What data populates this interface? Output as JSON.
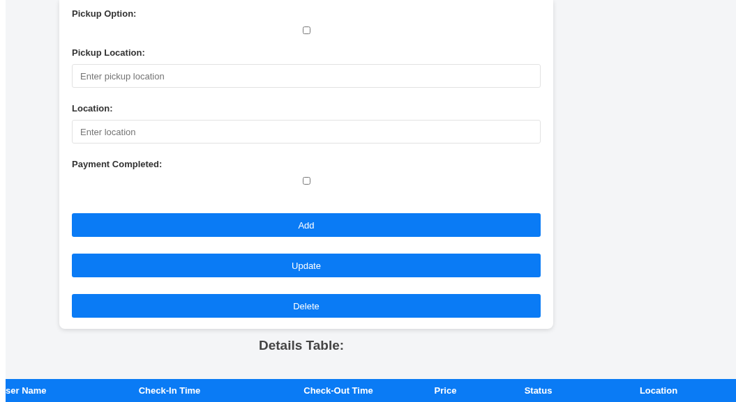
{
  "form": {
    "fields": [
      {
        "kind": "checkbox",
        "label": "Pickup Option:",
        "checked": false
      },
      {
        "kind": "text",
        "label": "Pickup Location:",
        "placeholder": "Enter pickup location"
      },
      {
        "kind": "text",
        "label": "Location:",
        "placeholder": "Enter location"
      },
      {
        "kind": "checkbox",
        "label": "Payment Completed:",
        "checked": false
      }
    ],
    "buttons": [
      "Add",
      "Update",
      "Delete"
    ]
  },
  "table": {
    "title": "Details Table:",
    "columns": [
      "ser Name",
      "Check-In Time",
      "Check-Out Time",
      "Price",
      "Status",
      "Location"
    ]
  }
}
